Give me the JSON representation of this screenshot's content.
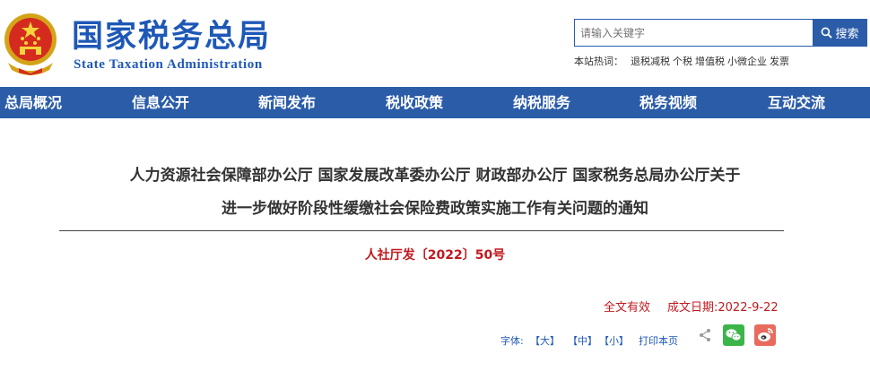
{
  "header": {
    "logo_cn": "国家税务总局",
    "logo_en": "State Taxation Administration"
  },
  "search": {
    "placeholder": "请输入关键字",
    "button_label": "搜索",
    "hotwords_label": "本站热词：",
    "hotwords": [
      "退税减税",
      "个税",
      "增值税",
      "小微企业",
      "发票"
    ]
  },
  "nav": {
    "items": [
      "总局概况",
      "信息公开",
      "新闻发布",
      "税收政策",
      "纳税服务",
      "税务视频",
      "互动交流"
    ]
  },
  "article": {
    "title_line1": "人力资源社会保障部办公厅 国家发展改革委办公厅 财政部办公厅 国家税务总局办公厅关于",
    "title_line2": "进一步做好阶段性缓缴社会保险费政策实施工作有关问题的通知",
    "doc_number": "人社厅发〔2022〕50号",
    "validity": "全文有效",
    "date_label": "成文日期:",
    "date": "2022-9-22"
  },
  "tools": {
    "font_label": "字体:",
    "size_large": "【大】",
    "size_medium": "【中】",
    "size_small": "【小】",
    "print_label": "打印本页"
  },
  "colors": {
    "brand_blue": "#2a5ca8",
    "logo_blue": "#1e58b7",
    "doc_red": "#c0191f",
    "wechat_green": "#3bb54a",
    "weibo_red": "#e86b5e"
  },
  "icons": [
    "national-emblem-icon",
    "search-icon",
    "share-icon",
    "wechat-icon",
    "weibo-icon"
  ]
}
